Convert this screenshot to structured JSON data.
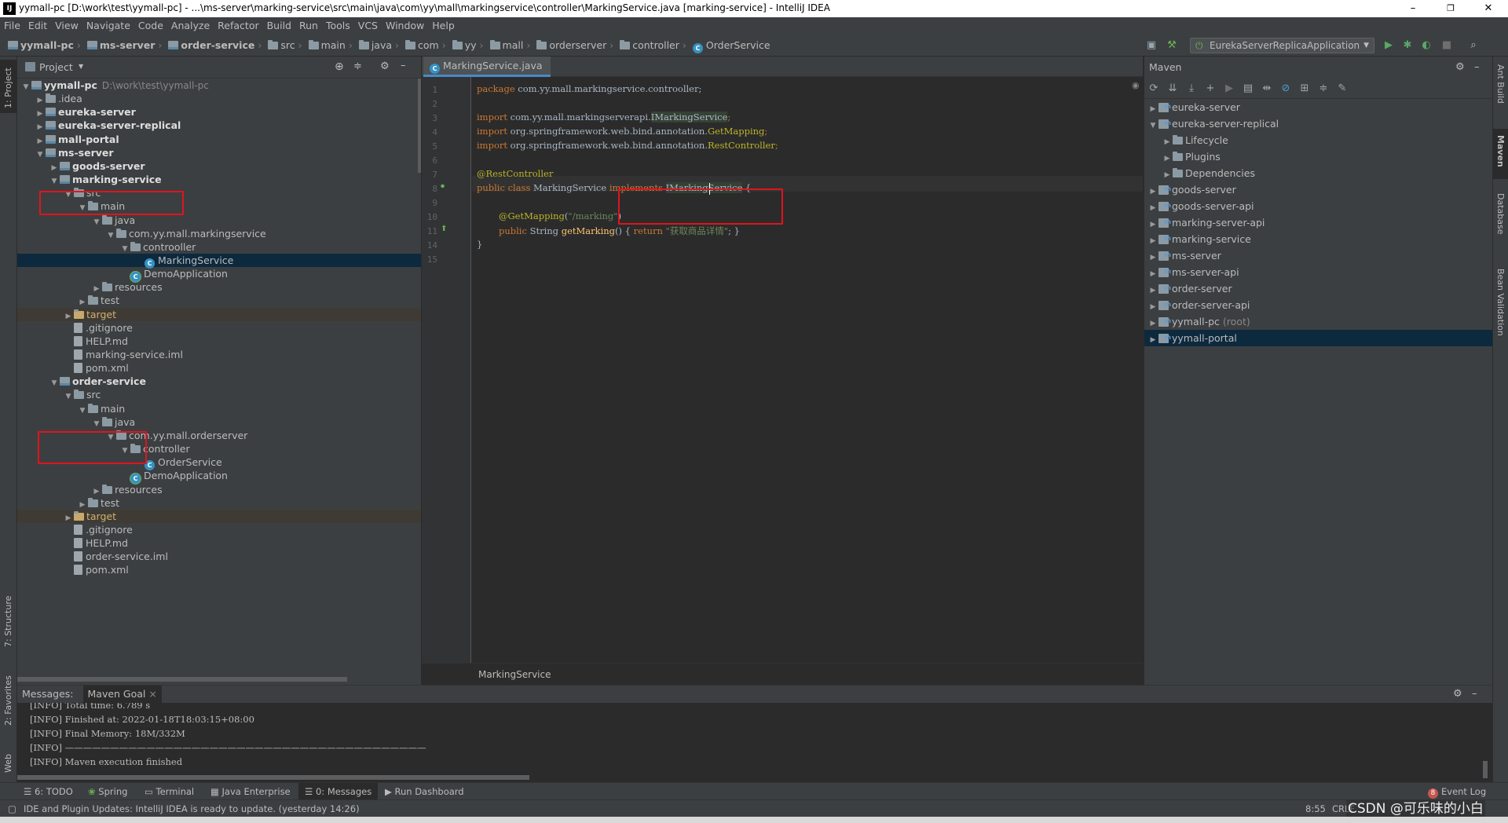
{
  "window": {
    "title": "yymall-pc [D:\\work\\test\\yymall-pc] - ...\\ms-server\\marking-service\\src\\main\\java\\com\\yy\\mall\\markingservice\\controller\\MarkingService.java [marking-service] - IntelliJ IDEA",
    "logo": "IJ",
    "minimize": "–",
    "maximize": "❐",
    "close": "✕"
  },
  "menu": [
    "File",
    "Edit",
    "View",
    "Navigate",
    "Code",
    "Analyze",
    "Refactor",
    "Build",
    "Run",
    "Tools",
    "VCS",
    "Window",
    "Help"
  ],
  "breadcrumbs": [
    "yymall-pc",
    "ms-server",
    "order-service",
    "src",
    "main",
    "java",
    "com",
    "yy",
    "mall",
    "orderserver",
    "controller",
    "OrderService"
  ],
  "toolbar": {
    "run_config": "EurekaServerReplicaApplication",
    "icons": [
      "layout-icon",
      "hammer-icon",
      "run-icon",
      "debug-icon",
      "coverage-icon",
      "stop-icon",
      "search-icon"
    ]
  },
  "left_stripe": {
    "project_tab": "1: Project",
    "structure_tab": "7: Structure",
    "favorites_tab": "2: Favorites",
    "web_tab": "Web"
  },
  "project": {
    "header": "Project",
    "tree": [
      {
        "label": "yymall-pc",
        "extra": "D:\\work\\test\\yymall-pc",
        "depth": 0,
        "arrow": "▼",
        "kind": "module",
        "bold": true
      },
      {
        "label": ".idea",
        "depth": 1,
        "arrow": "▶",
        "kind": "folder"
      },
      {
        "label": "eureka-server",
        "depth": 1,
        "arrow": "▶",
        "kind": "module",
        "bold": true
      },
      {
        "label": "eureka-server-replical",
        "depth": 1,
        "arrow": "▶",
        "kind": "module",
        "bold": true
      },
      {
        "label": "mall-portal",
        "depth": 1,
        "arrow": "▶",
        "kind": "module",
        "bold": true
      },
      {
        "label": "ms-server",
        "depth": 1,
        "arrow": "▼",
        "kind": "module",
        "bold": true
      },
      {
        "label": "goods-server",
        "depth": 2,
        "arrow": "▶",
        "kind": "module",
        "bold": true
      },
      {
        "label": "marking-service",
        "depth": 2,
        "arrow": "▼",
        "kind": "module",
        "bold": true
      },
      {
        "label": "src",
        "depth": 3,
        "arrow": "▼",
        "kind": "folder"
      },
      {
        "label": "main",
        "depth": 4,
        "arrow": "▼",
        "kind": "folder"
      },
      {
        "label": "java",
        "depth": 5,
        "arrow": "▼",
        "kind": "folder"
      },
      {
        "label": "com.yy.mall.markingservice",
        "depth": 6,
        "arrow": "▼",
        "kind": "folder"
      },
      {
        "label": "controoller",
        "depth": 7,
        "arrow": "▼",
        "kind": "folder"
      },
      {
        "label": "MarkingService",
        "depth": 8,
        "arrow": "",
        "kind": "class",
        "selected": true
      },
      {
        "label": "DemoApplication",
        "depth": 7,
        "arrow": "",
        "kind": "springclass"
      },
      {
        "label": "resources",
        "depth": 5,
        "arrow": "▶",
        "kind": "folder"
      },
      {
        "label": "test",
        "depth": 4,
        "arrow": "▶",
        "kind": "folder"
      },
      {
        "label": "target",
        "depth": 3,
        "arrow": "▶",
        "kind": "folder",
        "excluded": true
      },
      {
        "label": ".gitignore",
        "depth": 3,
        "arrow": "",
        "kind": "file"
      },
      {
        "label": "HELP.md",
        "depth": 3,
        "arrow": "",
        "kind": "file"
      },
      {
        "label": "marking-service.iml",
        "depth": 3,
        "arrow": "",
        "kind": "file"
      },
      {
        "label": "pom.xml",
        "depth": 3,
        "arrow": "",
        "kind": "file"
      },
      {
        "label": "order-service",
        "depth": 2,
        "arrow": "▼",
        "kind": "module",
        "bold": true
      },
      {
        "label": "src",
        "depth": 3,
        "arrow": "▼",
        "kind": "folder"
      },
      {
        "label": "main",
        "depth": 4,
        "arrow": "▼",
        "kind": "folder"
      },
      {
        "label": "java",
        "depth": 5,
        "arrow": "▼",
        "kind": "folder"
      },
      {
        "label": "com.yy.mall.orderserver",
        "depth": 6,
        "arrow": "▼",
        "kind": "folder"
      },
      {
        "label": "controller",
        "depth": 7,
        "arrow": "▼",
        "kind": "folder"
      },
      {
        "label": "OrderService",
        "depth": 8,
        "arrow": "",
        "kind": "class"
      },
      {
        "label": "DemoApplication",
        "depth": 7,
        "arrow": "",
        "kind": "springclass"
      },
      {
        "label": "resources",
        "depth": 5,
        "arrow": "▶",
        "kind": "folder"
      },
      {
        "label": "test",
        "depth": 4,
        "arrow": "▶",
        "kind": "folder"
      },
      {
        "label": "target",
        "depth": 3,
        "arrow": "▶",
        "kind": "folder",
        "excluded": true
      },
      {
        "label": ".gitignore",
        "depth": 3,
        "arrow": "",
        "kind": "file"
      },
      {
        "label": "HELP.md",
        "depth": 3,
        "arrow": "",
        "kind": "file"
      },
      {
        "label": "order-service.iml",
        "depth": 3,
        "arrow": "",
        "kind": "file"
      },
      {
        "label": "pom.xml",
        "depth": 3,
        "arrow": "",
        "kind": "file"
      }
    ]
  },
  "editor": {
    "tab": "MarkingService.java",
    "tab_close": "×",
    "line_numbers": [
      "1",
      "2",
      "3",
      "4",
      "5",
      "6",
      "7",
      "8",
      "9",
      "10",
      "11",
      "14",
      "15"
    ],
    "code": {
      "l1_kw": "package",
      "l1_rest": " com.yy.mall.markingservice.controoller;",
      "l3_kw": "import",
      "l3_pkg": " com.yy.mall.markingserverapi.",
      "l3_ref": "IMarkingService",
      "l3_end": ";",
      "l4_kw": "import",
      "l4_pkg": " org.springframework.web.bind.annotation.",
      "l4_ref": "GetMapping",
      "l4_end": ";",
      "l5_kw": "import",
      "l5_pkg": " org.springframework.web.bind.annotation.",
      "l5_ref": "RestController",
      "l5_end": ";",
      "l7_ann": "@RestController",
      "l8_kw1": "public class",
      "l8_name": " MarkingService ",
      "l8_kw2": "implements",
      "l8_iface": "IMarkingService",
      "l8_end": " {",
      "l10_ann": "@GetMapping",
      "l10_open": "(",
      "l10_str": "\"/marking\"",
      "l10_close": ")",
      "l11_kw": "public",
      "l11_type": " String ",
      "l11_meth": "getMarking",
      "l11_mid": "() { ",
      "l11_kw2": "return",
      "l11_str": " \"获取商品详情\"",
      "l11_end": "; }",
      "l14": "}"
    },
    "breadcrumb": "MarkingService"
  },
  "maven": {
    "header": "Maven",
    "tree": [
      {
        "label": "eureka-server",
        "depth": 0,
        "arrow": "▶"
      },
      {
        "label": "eureka-server-replical",
        "depth": 0,
        "arrow": "▼"
      },
      {
        "label": "Lifecycle",
        "depth": 1,
        "arrow": "▶"
      },
      {
        "label": "Plugins",
        "depth": 1,
        "arrow": "▶"
      },
      {
        "label": "Dependencies",
        "depth": 1,
        "arrow": "▶"
      },
      {
        "label": "goods-server",
        "depth": 0,
        "arrow": "▶"
      },
      {
        "label": "goods-server-api",
        "depth": 0,
        "arrow": "▶"
      },
      {
        "label": "marking-server-api",
        "depth": 0,
        "arrow": "▶"
      },
      {
        "label": "marking-service",
        "depth": 0,
        "arrow": "▶"
      },
      {
        "label": "ms-server",
        "depth": 0,
        "arrow": "▶"
      },
      {
        "label": "ms-server-api",
        "depth": 0,
        "arrow": "▶"
      },
      {
        "label": "order-server",
        "depth": 0,
        "arrow": "▶"
      },
      {
        "label": "order-server-api",
        "depth": 0,
        "arrow": "▶"
      },
      {
        "label": "yymall-pc",
        "extra": "(root)",
        "depth": 0,
        "arrow": "▶"
      },
      {
        "label": "yymall-portal",
        "depth": 0,
        "arrow": "▶",
        "selected": true
      }
    ]
  },
  "right_stripe": {
    "ant": "Ant Build",
    "maven": "Maven",
    "database": "Database",
    "bean": "Bean Validation"
  },
  "messages": {
    "tab_label": "Messages:",
    "tab_name": "Maven Goal",
    "tab_close": "×",
    "lines": [
      "[INFO] Total time: 6.789 s",
      "[INFO] Finished at: 2022-01-18T18:03:15+08:00",
      "[INFO] Final Memory: 18M/332M",
      "[INFO] ————————————————————————————————————————",
      "[INFO] Maven execution finished"
    ]
  },
  "toolstrip": {
    "todo": "6: TODO",
    "spring": "Spring",
    "terminal": "Terminal",
    "java_enterprise": "Java Enterprise",
    "messages": "0: Messages",
    "run_dashboard": "Run Dashboard",
    "event_log": "Event Log",
    "event_count": "8"
  },
  "status": {
    "message": "IDE and Plugin Updates: IntelliJ IDEA is ready to update. (yesterday 14:26)",
    "position": "8:55",
    "encoding": "CRLF",
    "watermark": "CSDN @可乐味的小白"
  },
  "colors": {
    "highlight_box": "#e0141e",
    "selection": "#0d293e",
    "accent": "#4a88c7"
  }
}
